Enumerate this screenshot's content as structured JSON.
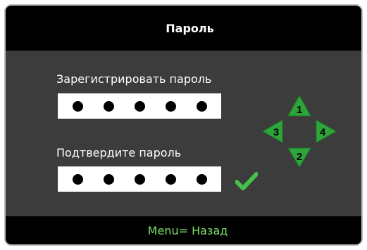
{
  "dialog": {
    "title": "Пароль",
    "register_label": "Зарегистрировать пароль",
    "confirm_label": "Подтвердите пароль",
    "register_mask": [
      "●",
      "●",
      "●",
      "●",
      "●"
    ],
    "confirm_mask": [
      "●",
      "●",
      "●",
      "●",
      "●"
    ],
    "check_icon": "checkmark-icon",
    "accent_color": "#44c24a"
  },
  "keypad": {
    "up": "1",
    "down": "2",
    "left": "3",
    "right": "4"
  },
  "footer": {
    "hint": "Menu= Назад"
  }
}
